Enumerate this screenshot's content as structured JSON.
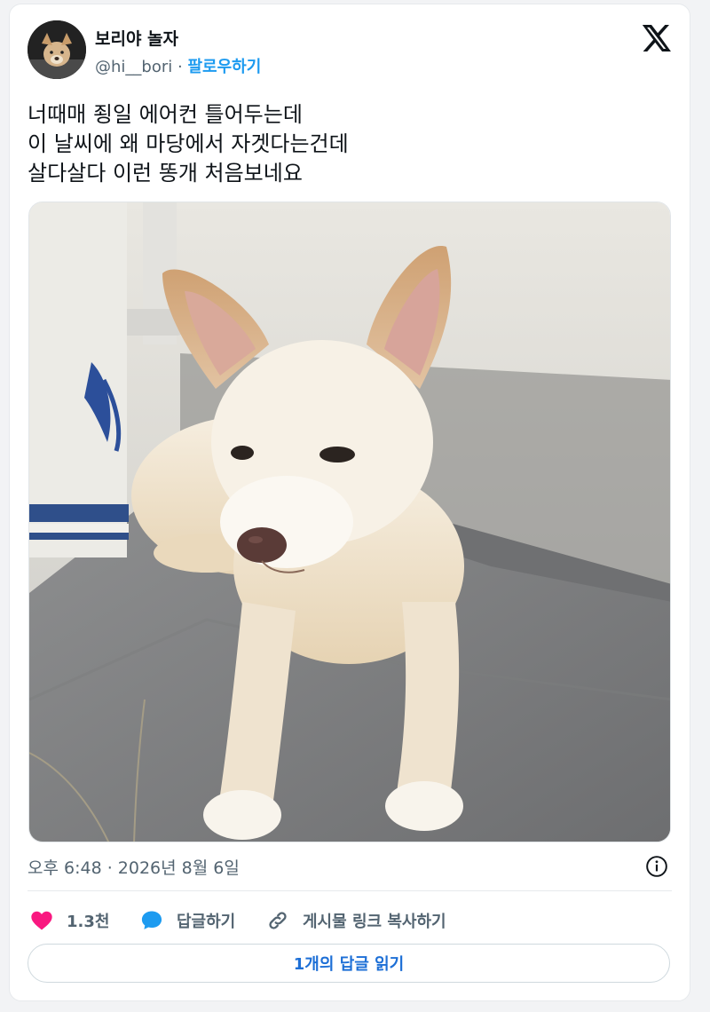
{
  "author": {
    "name": "보리야 놀자",
    "handle": "@hi__bori",
    "separator": "·",
    "follow_label": "팔로우하기"
  },
  "tweet": {
    "lines": [
      "너때매 죙일 에어컨 틀어두는데",
      "이 날씨에 왜 마당에서 자겟다는건데",
      "살다살다 이런 똥개 처음보네요"
    ]
  },
  "meta": {
    "timestamp": "오후 6:48 · 2026년 8월 6일"
  },
  "actions": {
    "like_count": "1.3천",
    "reply_label": "답글하기",
    "copy_link_label": "게시물 링크 복사하기"
  },
  "read_replies_label": "1개의 답글 읽기",
  "icons": {
    "platform": "x-logo-icon",
    "info": "info-icon",
    "like": "heart-icon",
    "reply": "speech-bubble-icon",
    "copy": "link-icon"
  },
  "colors": {
    "link_blue": "#1d9bf0",
    "like_pink": "#f91880",
    "reply_blue": "#1d9bf0",
    "muted_text": "#536471"
  }
}
